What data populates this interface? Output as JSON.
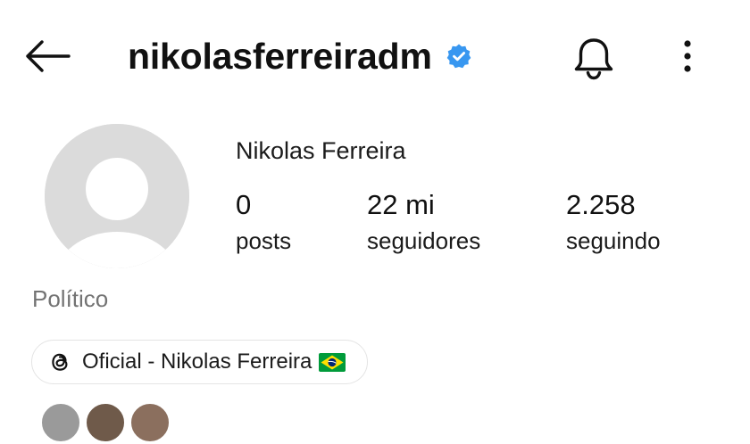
{
  "header": {
    "username": "nikolasferreiradm",
    "back_icon": "arrow-left-icon",
    "verified_icon": "verified-badge-icon",
    "notifications_icon": "bell-icon",
    "more_icon": "more-vertical-icon",
    "verified_color": "#3897f0"
  },
  "profile": {
    "display_name": "Nikolas Ferreira",
    "stats": {
      "posts_count": "0",
      "posts_label": "posts",
      "followers_count": "22 mi",
      "followers_label": "seguidores",
      "following_count": "2.258",
      "following_label": "seguindo"
    },
    "category": "Político",
    "threads": {
      "icon": "threads-icon",
      "label": "Oficial - Nikolas Ferreira",
      "flag_icon": "brazil-flag-icon"
    }
  }
}
